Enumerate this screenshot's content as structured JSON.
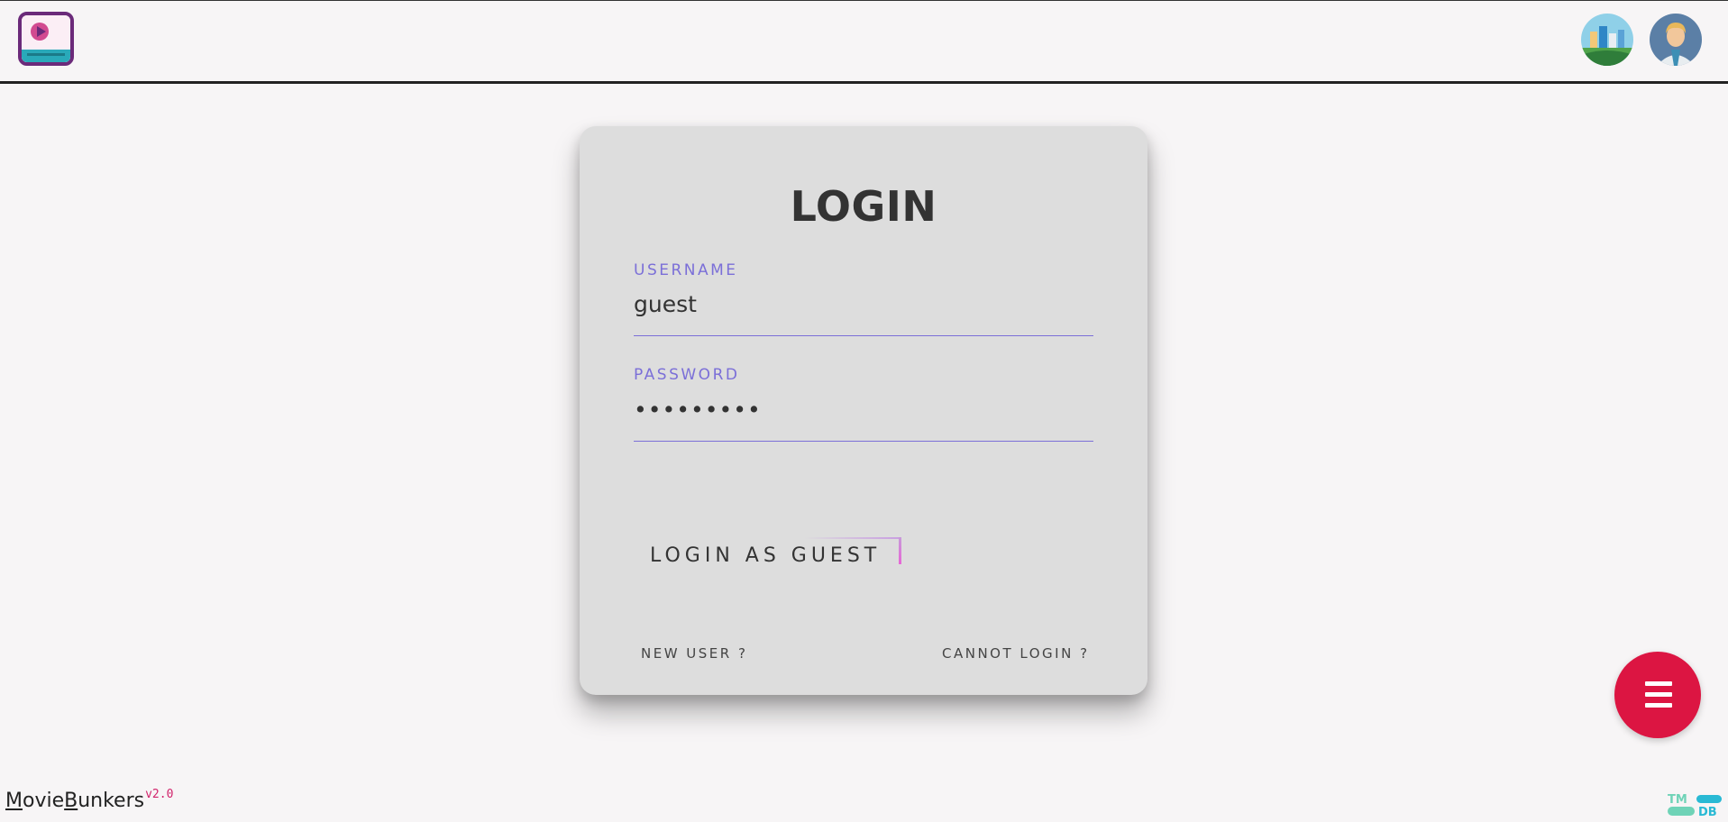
{
  "header": {
    "logo_icon": "play-video-icon",
    "avatars": [
      {
        "icon": "city-avatar-icon"
      },
      {
        "icon": "user-avatar-icon"
      }
    ]
  },
  "login": {
    "title": "LOGIN",
    "username": {
      "label": "USERNAME",
      "value": "guest"
    },
    "password": {
      "label": "PASSWORD",
      "masked_value": "•••••••••"
    },
    "guest_button_label": "LOGIN AS GUEST",
    "new_user_label": "NEW USER ?",
    "cannot_login_label": "CANNOT LOGIN ?"
  },
  "fab": {
    "icon": "menu-icon"
  },
  "footer": {
    "brand_m": "M",
    "brand_ovie": "ovie",
    "brand_b": "B",
    "brand_unkers": "unkers",
    "version": "v2.0",
    "tmdb_tm": "TM",
    "tmdb_db": "DB"
  },
  "colors": {
    "accent_purple": "#7b6fd8",
    "fab_red": "#dc1542",
    "card_bg": "#dddddd",
    "page_bg": "#f7f5f6"
  }
}
